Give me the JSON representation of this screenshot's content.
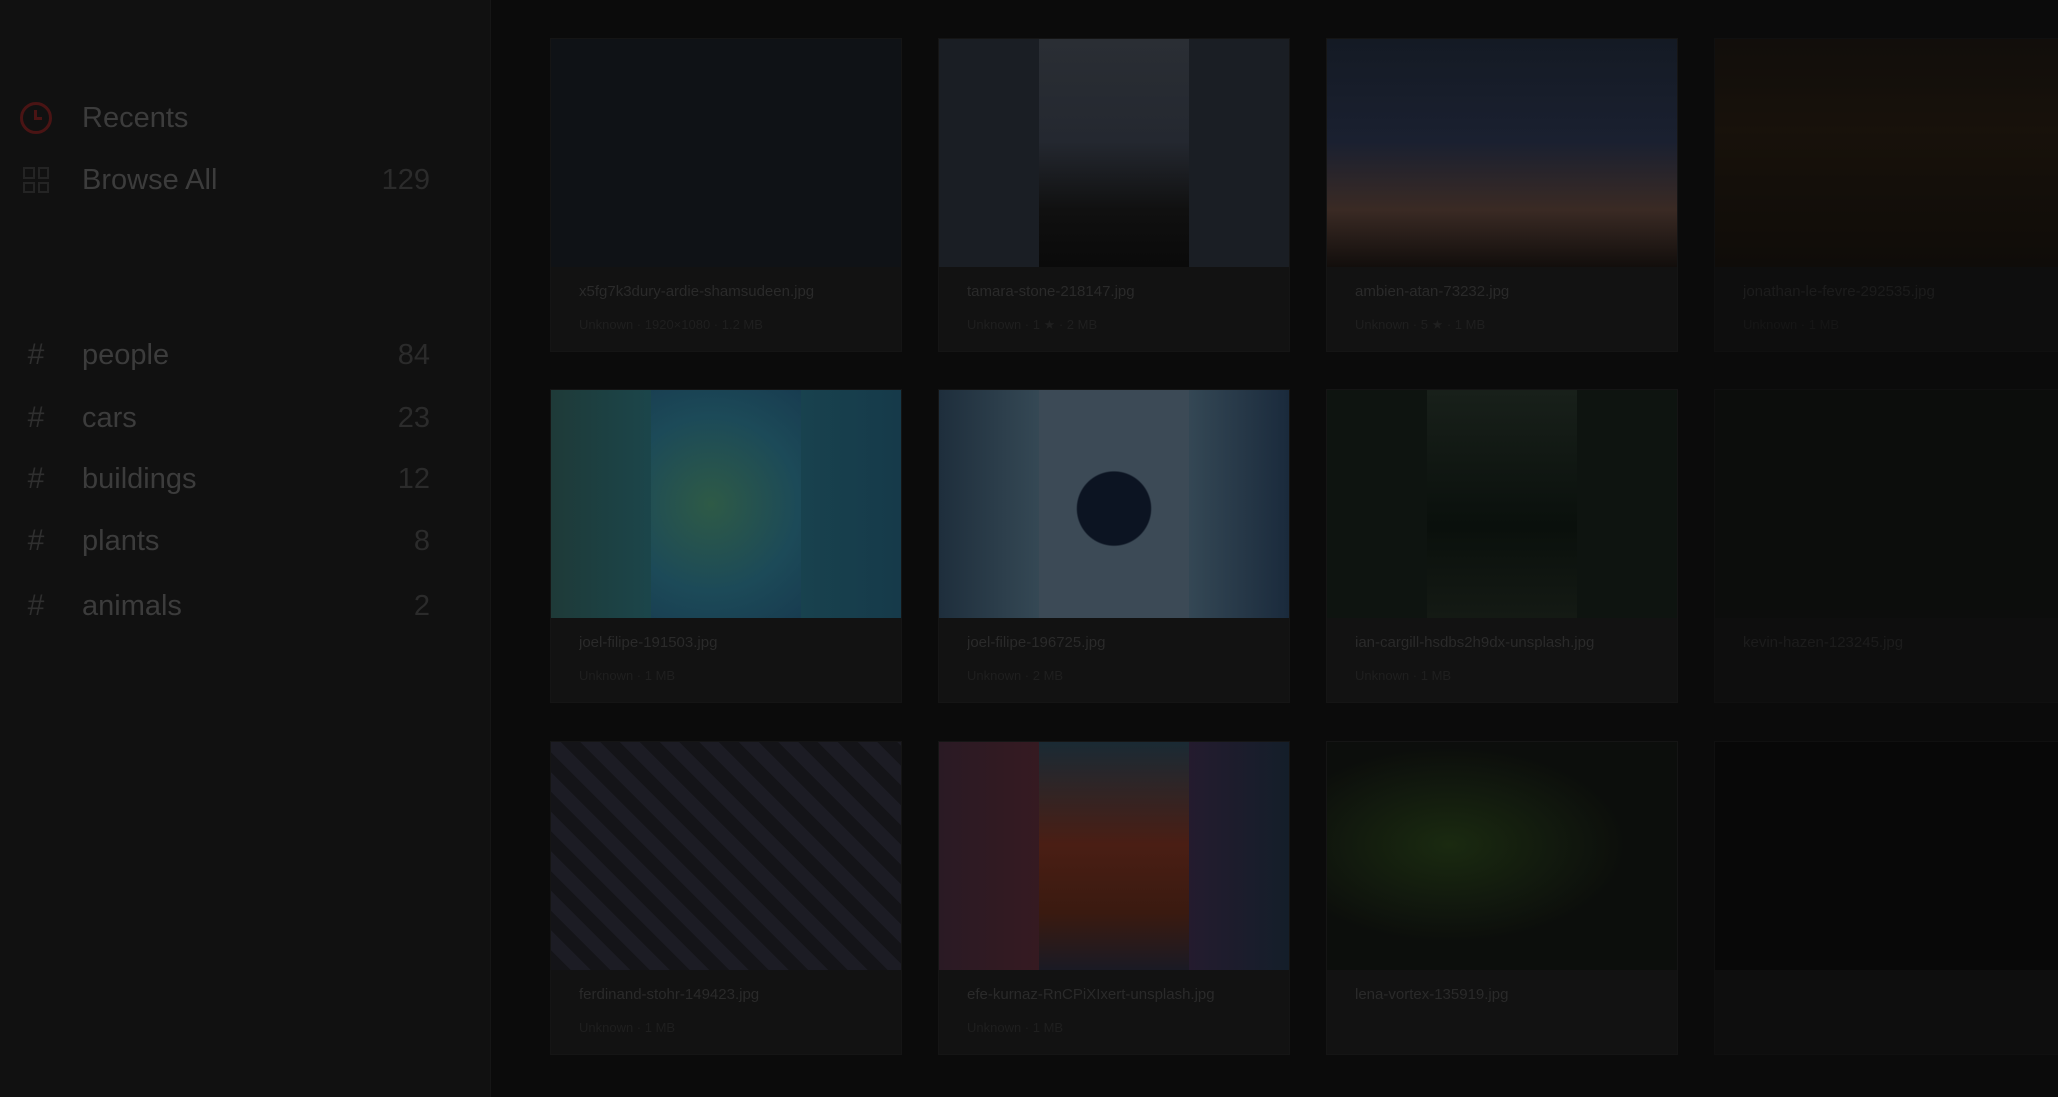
{
  "sidebar": {
    "nav": [
      {
        "label": "Recents",
        "count": "",
        "icon": "clock-icon"
      },
      {
        "label": "Browse All",
        "count": "129",
        "icon": "grid-icon"
      }
    ],
    "tags": [
      {
        "label": "people",
        "count": "84"
      },
      {
        "label": "cars",
        "count": "23"
      },
      {
        "label": "buildings",
        "count": "12"
      },
      {
        "label": "plants",
        "count": "8"
      },
      {
        "label": "animals",
        "count": "2"
      }
    ]
  },
  "files": [
    {
      "name": "x5fg7k3dury-ardie-shamsudeen.jpg",
      "meta": "Unknown · 1920×1080 · 1.2 MB"
    },
    {
      "name": "tamara-stone-218147.jpg",
      "meta": "Unknown · 1 ★ · 2 MB"
    },
    {
      "name": "ambien-atan-73232.jpg",
      "meta": "Unknown · 5 ★ · 1 MB"
    },
    {
      "name": "jonathan-le-fevre-292535.jpg",
      "meta": "Unknown · 1 MB"
    },
    {
      "name": "joel-filipe-191503.jpg",
      "meta": "Unknown · 1 MB"
    },
    {
      "name": "joel-filipe-196725.jpg",
      "meta": "Unknown · 2 MB"
    },
    {
      "name": "ian-cargill-hsdbs2h9dx-unsplash.jpg",
      "meta": "Unknown · 1 MB"
    },
    {
      "name": "kevin-hazen-123245.jpg",
      "meta": ""
    },
    {
      "name": "ferdinand-stohr-149423.jpg",
      "meta": "Unknown · 1 MB"
    },
    {
      "name": "efe-kurnaz-RnCPiXIxert-unsplash.jpg",
      "meta": "Unknown · 1 MB"
    },
    {
      "name": "lena-vortex-135919.jpg",
      "meta": ""
    },
    {
      "name": "",
      "meta": ""
    }
  ]
}
